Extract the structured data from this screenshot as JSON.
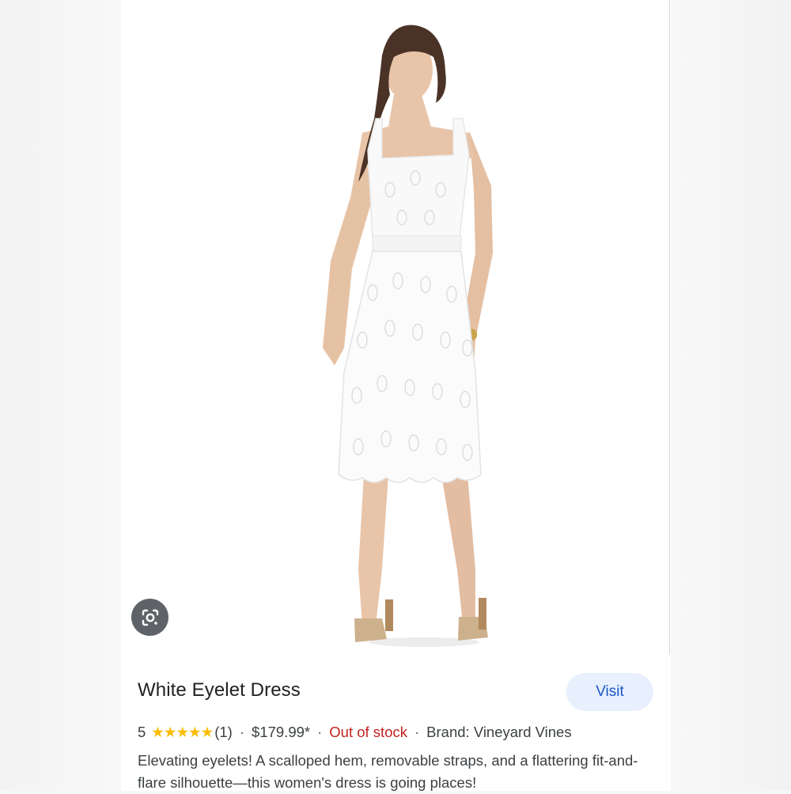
{
  "product": {
    "title": "White Eyelet Dress",
    "visit_label": "Visit",
    "rating": "5",
    "stars": "★★★★★",
    "review_count": "(1)",
    "price": "$179.99*",
    "stock_status": "Out of stock",
    "brand": "Brand: Vineyard Vines",
    "separator": "·",
    "description": "Elevating eyelets! A scalloped hem, removable straps, and a flattering fit-and-flare silhouette—this women's dress is going places!"
  },
  "colors": {
    "visit_bg": "#e8f0fe",
    "visit_text": "#1a56c7",
    "stars": "#fbbc04",
    "out_of_stock": "#c5221f",
    "lens_button": "#5f6368"
  },
  "icons": {
    "lens": "google-lens-icon",
    "star": "star-icon"
  }
}
